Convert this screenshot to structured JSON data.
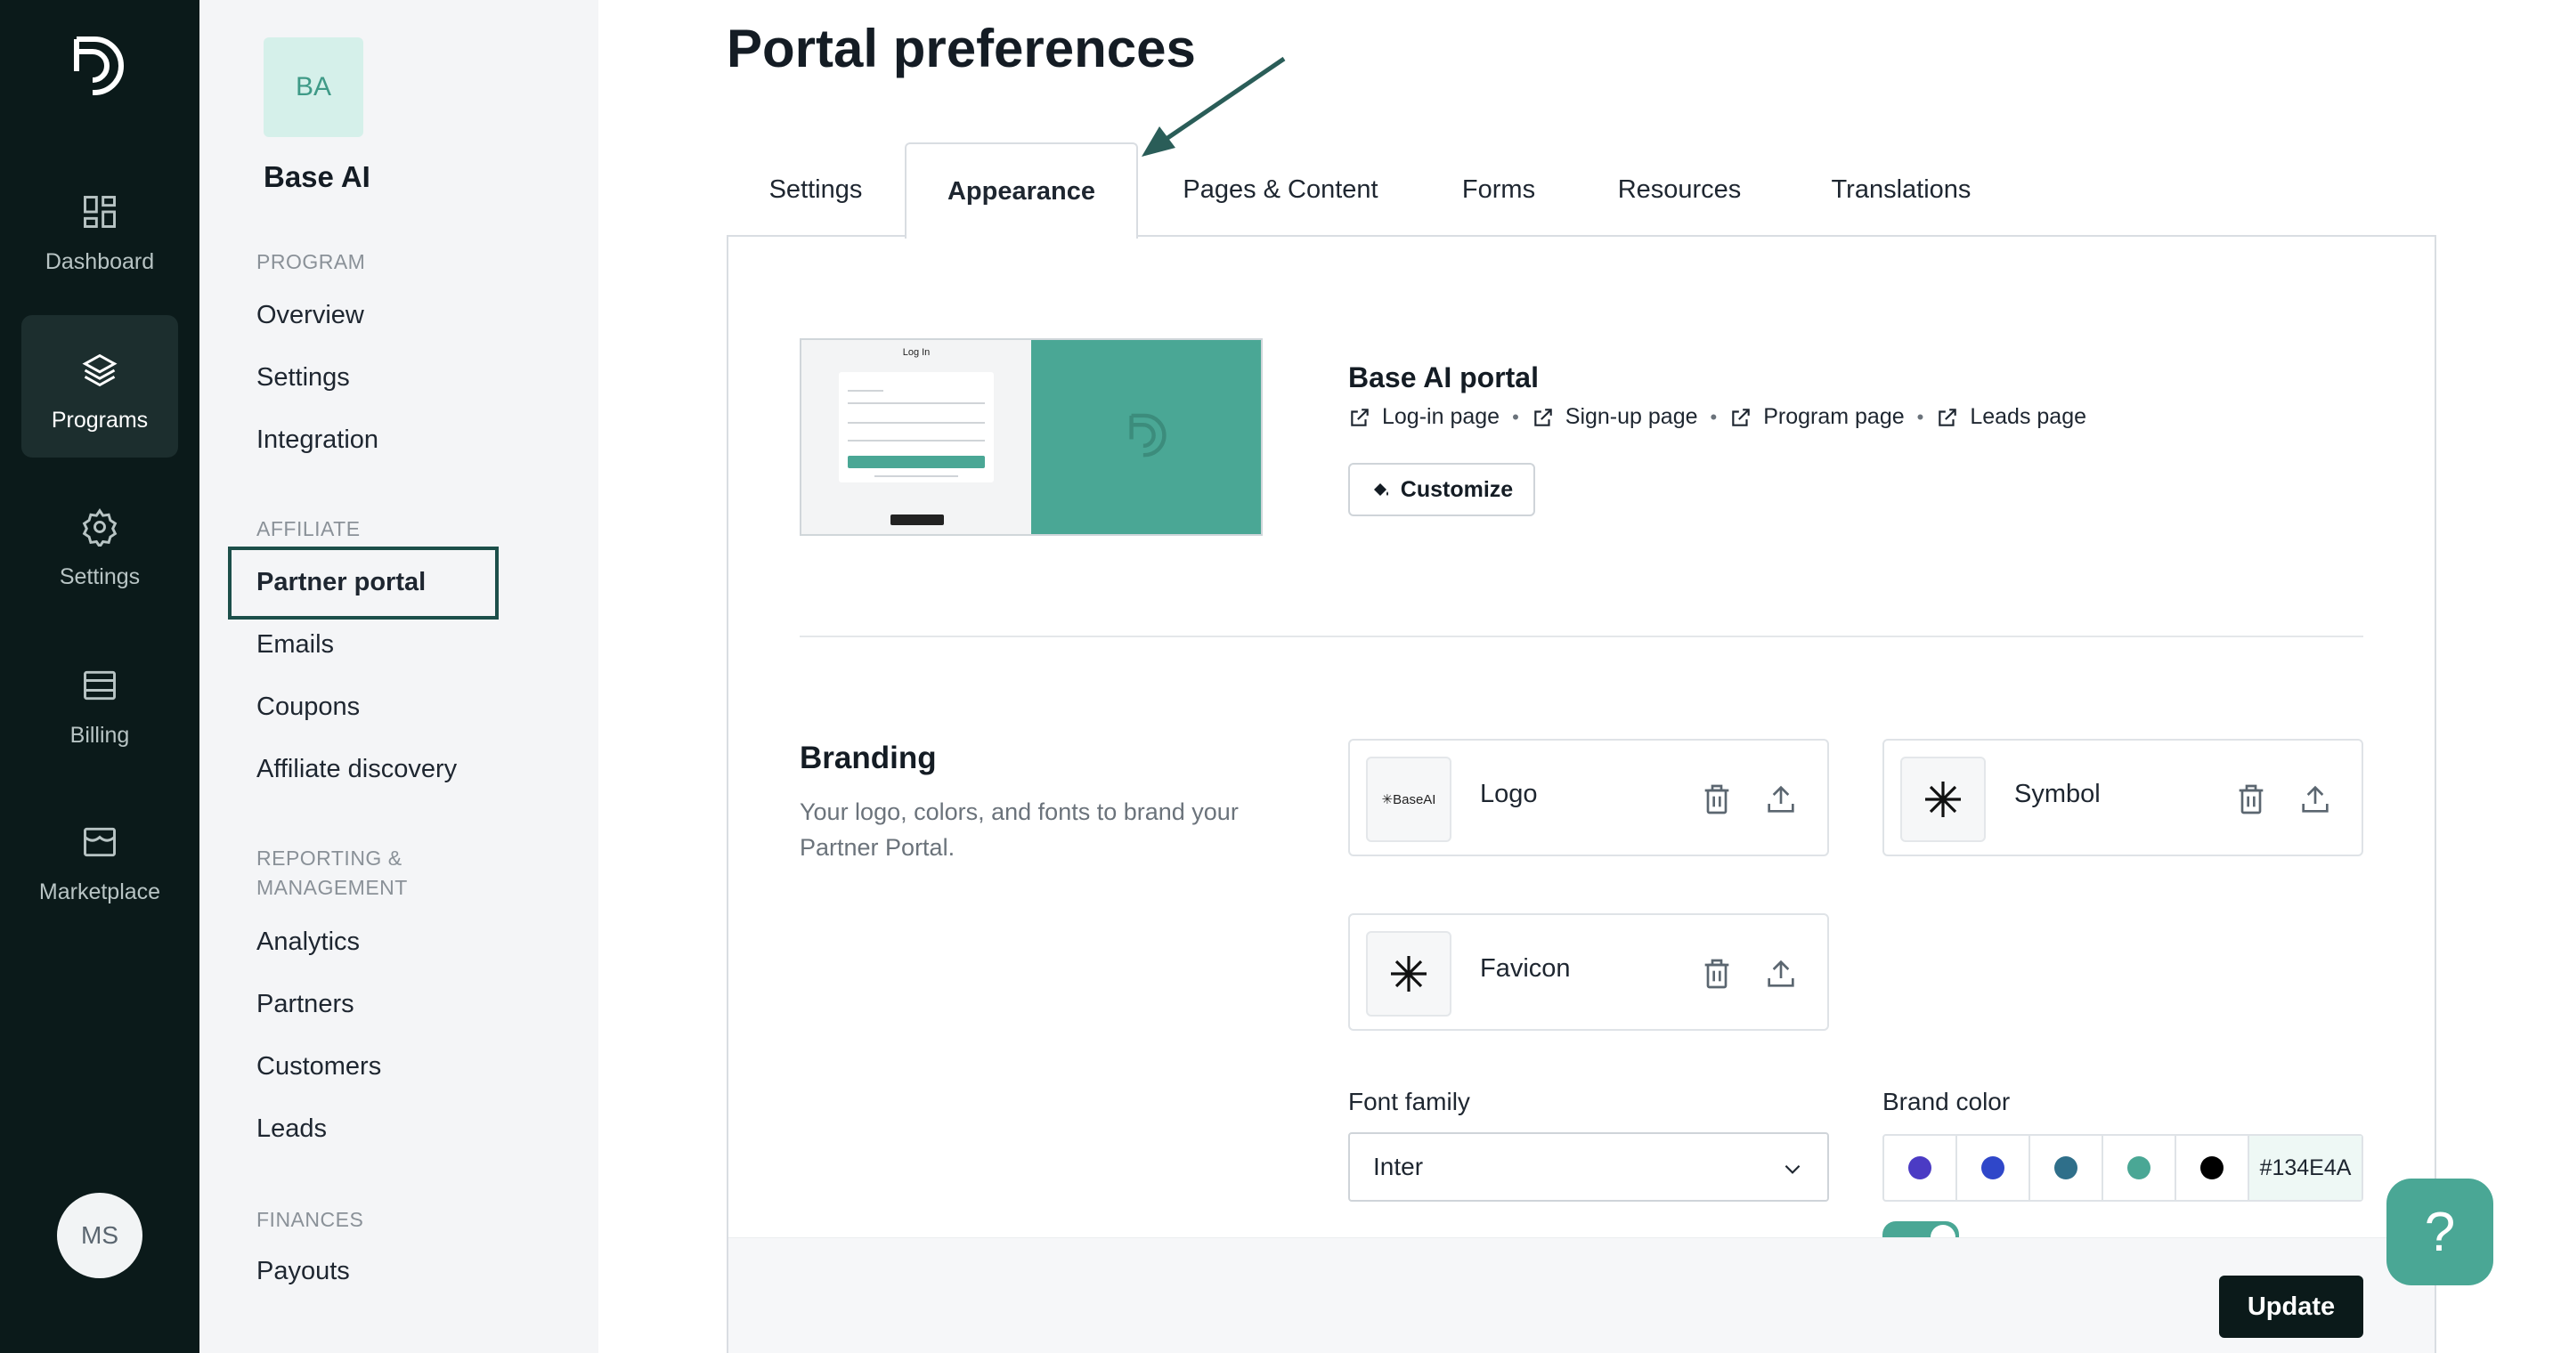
{
  "colors": {
    "rail_bg": "#0b1a1a",
    "accent": "#4aa795",
    "active_box": "#1c4f4a",
    "brand": "#134E4A"
  },
  "rail": {
    "items": [
      {
        "label": "Dashboard",
        "icon": "dashboard-icon"
      },
      {
        "label": "Programs",
        "icon": "layers-icon"
      },
      {
        "label": "Settings",
        "icon": "gear-icon"
      },
      {
        "label": "Billing",
        "icon": "billing-icon"
      },
      {
        "label": "Marketplace",
        "icon": "store-icon"
      }
    ],
    "avatar": "MS"
  },
  "sidebar": {
    "org_badge": "BA",
    "org_name": "Base AI",
    "sections": [
      {
        "title": "PROGRAM",
        "items": [
          "Overview",
          "Settings",
          "Integration"
        ]
      },
      {
        "title": "AFFILIATE",
        "items": [
          "Partner portal",
          "Emails",
          "Coupons",
          "Affiliate discovery"
        ]
      },
      {
        "title": "REPORTING & MANAGEMENT",
        "items": [
          "Analytics",
          "Partners",
          "Customers",
          "Leads"
        ]
      },
      {
        "title": "FINANCES",
        "items": [
          "Payouts"
        ]
      }
    ],
    "active_item": "Partner portal"
  },
  "main": {
    "title": "Portal preferences",
    "tabs": [
      "Settings",
      "Appearance",
      "Pages & Content",
      "Forms",
      "Resources",
      "Translations"
    ],
    "active_tab": "Appearance",
    "preview": {
      "login_title": "Log In"
    },
    "portal": {
      "name": "Base AI portal",
      "links": [
        "Log-in page",
        "Sign-up page",
        "Program page",
        "Leads page"
      ],
      "customize_label": "Customize"
    },
    "branding": {
      "title": "Branding",
      "description": "Your logo, colors, and fonts to brand your Partner Portal.",
      "assets": [
        {
          "label": "Logo",
          "thumb_text": "✳BaseAI"
        },
        {
          "label": "Symbol"
        },
        {
          "label": "Favicon"
        }
      ],
      "font_family_label": "Font family",
      "font_family_value": "Inter",
      "brand_color_label": "Brand color",
      "swatches": [
        "#4b3bc4",
        "#2f47c9",
        "#2f6f8a",
        "#4aa795",
        "#000000"
      ],
      "hex_value": "#134E4A"
    },
    "update_label": "Update"
  },
  "help_label": "?"
}
